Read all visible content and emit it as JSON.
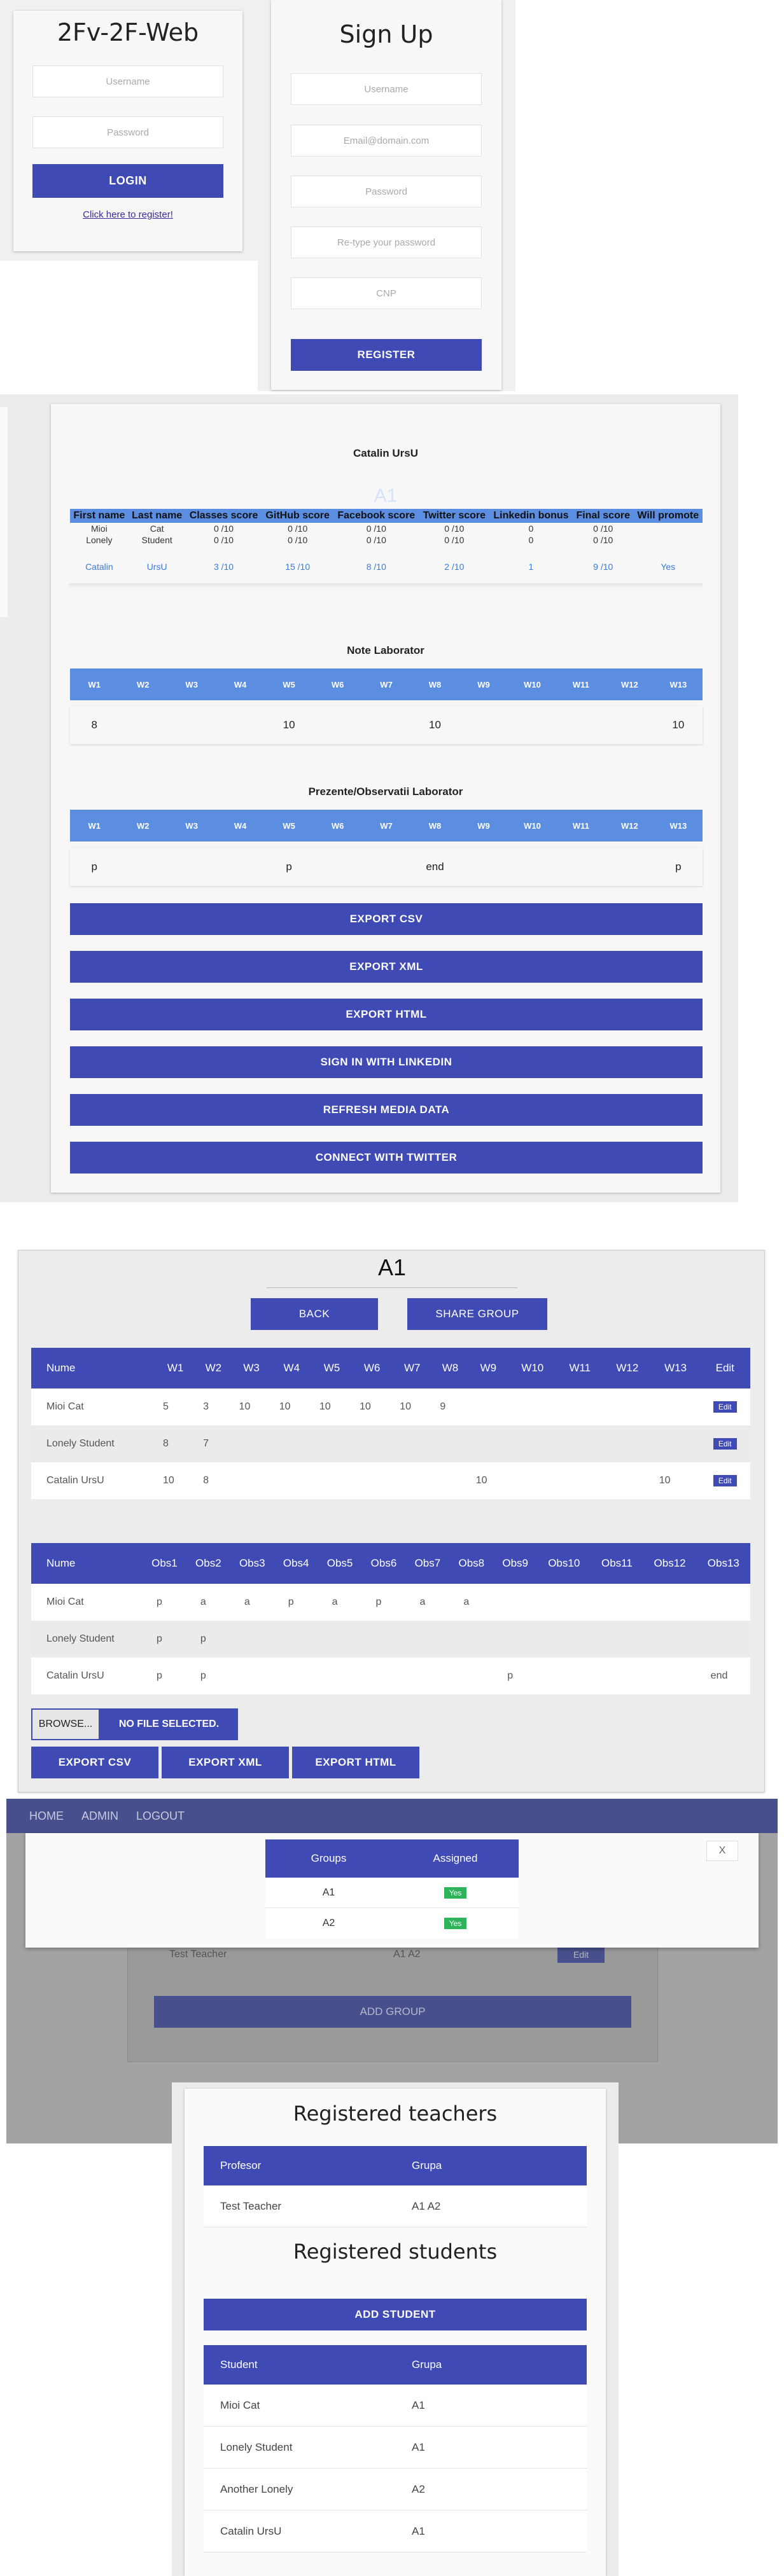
{
  "login": {
    "title": "2Fv-2F-Web",
    "username_placeholder": "Username",
    "password_placeholder": "Password",
    "login_button": "LOGIN",
    "register_link": "Click here to register!"
  },
  "signup": {
    "title": "Sign Up",
    "username_placeholder": "Username",
    "email_placeholder": "Email@domain.com",
    "password_placeholder": "Password",
    "retype_placeholder": "Re-type your password",
    "cnp_placeholder": "CNP",
    "register_button": "REGISTER"
  },
  "student": {
    "name": "Catalin UrsU",
    "group_watermark": "A1",
    "table_headers": [
      "First name",
      "Last name",
      "Classes score",
      "GitHub score",
      "Facebook score",
      "Twitter score",
      "Linkedin bonus",
      "Final score",
      "Will promote"
    ],
    "rows": [
      [
        "Mioi",
        "Cat",
        "0 /10",
        "0 /10",
        "0 /10",
        "0 /10",
        "0",
        "0 /10",
        ""
      ],
      [
        "Lonely",
        "Student",
        "0 /10",
        "0 /10",
        "0 /10",
        "0 /10",
        "0",
        "0 /10",
        ""
      ]
    ],
    "highlight_row": [
      "Catalin",
      "UrsU",
      "3 /10",
      "15 /10",
      "8 /10",
      "2 /10",
      "1",
      "9 /10",
      "Yes"
    ],
    "note_title": "Note Laborator",
    "weeks": [
      "W1",
      "W2",
      "W3",
      "W4",
      "W5",
      "W6",
      "W7",
      "W8",
      "W9",
      "W10",
      "W11",
      "W12",
      "W13"
    ],
    "notes": [
      "8",
      "",
      "",
      "",
      "10",
      "",
      "",
      "10",
      "",
      "",
      "",
      "",
      "10"
    ],
    "presence_title": "Prezente/Observatii Laborator",
    "presence": [
      "p",
      "",
      "",
      "",
      "p",
      "",
      "",
      "end",
      "",
      "",
      "",
      "",
      "p"
    ],
    "buttons": [
      "EXPORT CSV",
      "EXPORT XML",
      "EXPORT HTML",
      "SIGN IN WITH LINKEDIN",
      "REFRESH MEDIA DATA",
      "CONNECT WITH TWITTER"
    ]
  },
  "group": {
    "title": "A1",
    "back_button": "BACK",
    "share_button": "SHARE GROUP",
    "grades_headers": [
      "Nume",
      "W1",
      "W2",
      "W3",
      "W4",
      "W5",
      "W6",
      "W7",
      "W8",
      "W9",
      "W10",
      "W11",
      "W12",
      "W13",
      "Edit"
    ],
    "grades_rows": [
      [
        "Mioi Cat",
        "5",
        "3",
        "10",
        "10",
        "10",
        "10",
        "10",
        "9",
        "",
        "",
        "",
        "",
        "",
        ""
      ],
      [
        "Lonely Student",
        "8",
        "7",
        "",
        "",
        "",
        "",
        "",
        "",
        "",
        "",
        "",
        "",
        "",
        ""
      ],
      [
        "Catalin UrsU",
        "10",
        "8",
        "",
        "",
        "",
        "",
        "",
        "",
        "10",
        "",
        "",
        "",
        "10",
        ""
      ]
    ],
    "edit_label": "Edit",
    "obs_headers": [
      "Nume",
      "Obs1",
      "Obs2",
      "Obs3",
      "Obs4",
      "Obs5",
      "Obs6",
      "Obs7",
      "Obs8",
      "Obs9",
      "Obs10",
      "Obs11",
      "Obs12",
      "Obs13"
    ],
    "obs_rows": [
      [
        "Mioi Cat",
        "p",
        "a",
        "a",
        "p",
        "a",
        "p",
        "a",
        "a",
        "",
        "",
        "",
        "",
        ""
      ],
      [
        "Lonely Student",
        "p",
        "p",
        "",
        "",
        "",
        "",
        "",
        "",
        "",
        "",
        "",
        "",
        ""
      ],
      [
        "Catalin UrsU",
        "p",
        "p",
        "",
        "",
        "",
        "",
        "",
        "",
        "p",
        "",
        "",
        "",
        "end"
      ]
    ],
    "browse_label": "BROWSE...",
    "no_file_label": "NO FILE SELECTED.",
    "export_buttons": [
      "EXPORT CSV",
      "EXPORT XML",
      "EXPORT HTML"
    ]
  },
  "admin": {
    "menu": [
      "HOME",
      "ADMIN",
      "LOGOUT"
    ],
    "modal_headers": [
      "Groups",
      "Assigned"
    ],
    "modal_rows": [
      [
        "A1",
        "Yes"
      ],
      [
        "A2",
        "Yes"
      ]
    ],
    "close_label": "X",
    "bg_teacher": "Test Teacher",
    "bg_groups": "A1 A2",
    "bg_edit": "Edit",
    "add_group": "ADD GROUP"
  },
  "registry": {
    "teachers_title": "Registered teachers",
    "teacher_headers": [
      "Profesor",
      "Grupa"
    ],
    "teacher_rows": [
      [
        "Test Teacher",
        "A1 A2"
      ]
    ],
    "students_title": "Registered students",
    "add_student": "ADD STUDENT",
    "student_headers": [
      "Student",
      "Grupa"
    ],
    "student_rows": [
      [
        "Mioi Cat",
        "A1"
      ],
      [
        "Lonely Student",
        "A1"
      ],
      [
        "Another Lonely",
        "A2"
      ],
      [
        "Catalin UrsU",
        "A1"
      ]
    ]
  },
  "colors": {
    "primary": "#3f4ab5",
    "table_header_light": "#5b8ee0",
    "badge_yes": "#2db45a",
    "nav": "#474f8c"
  }
}
